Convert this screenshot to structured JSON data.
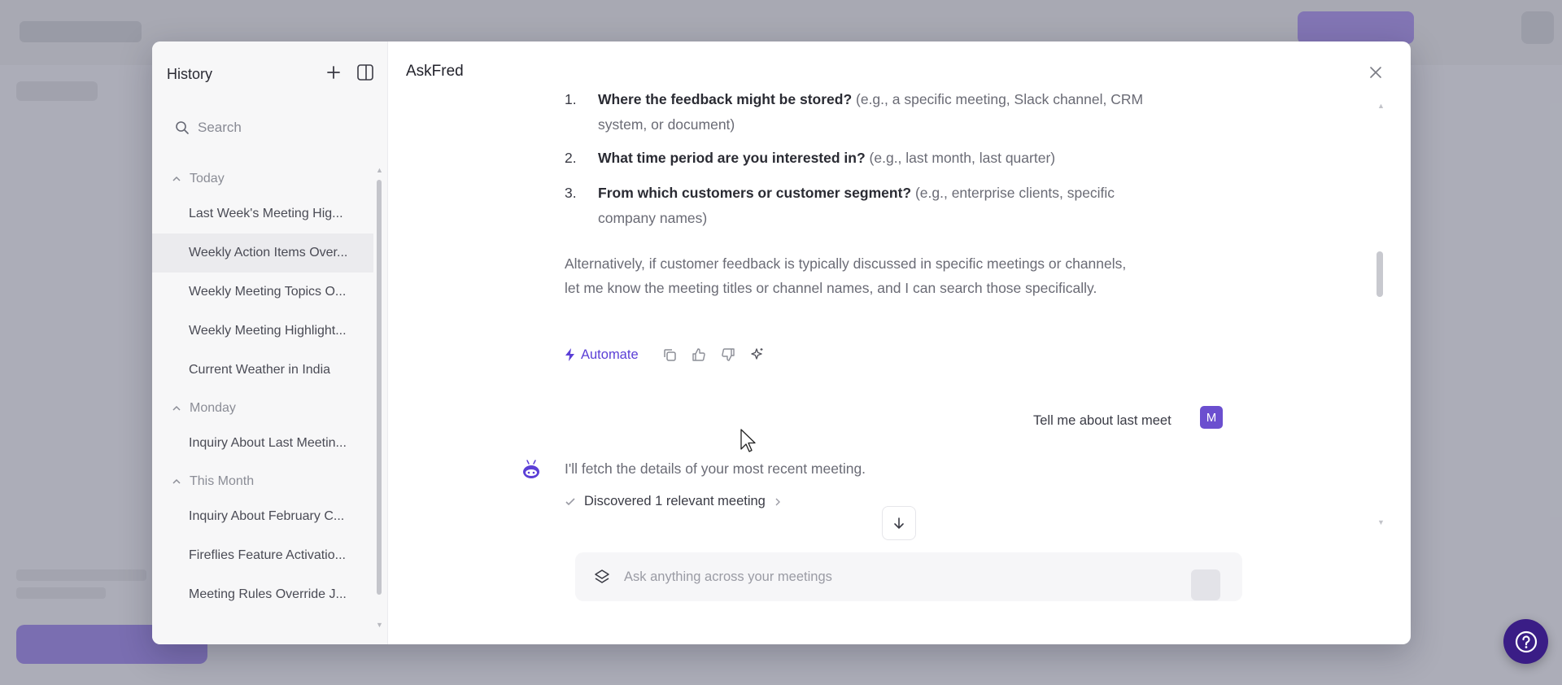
{
  "sidebar": {
    "title": "History",
    "search_placeholder": "Search",
    "groups": [
      {
        "label": "Today",
        "items": [
          "Last Week's Meeting Hig...",
          "Weekly Action Items Over...",
          "Weekly Meeting Topics O...",
          "Weekly Meeting Highlight...",
          "Current Weather in India"
        ]
      },
      {
        "label": "Monday",
        "items": [
          "Inquiry About Last Meetin..."
        ]
      },
      {
        "label": "This Month",
        "items": [
          "Inquiry About February C...",
          "Fireflies Feature Activatio...",
          "Meeting Rules Override J..."
        ]
      }
    ]
  },
  "main": {
    "title": "AskFred",
    "list": [
      {
        "num": "1.",
        "bold": "Where the feedback might be stored?",
        "rest": " (e.g., a specific meeting, Slack channel, CRM system, or document)"
      },
      {
        "num": "2.",
        "bold": "What time period are you interested in?",
        "rest": " (e.g., last month, last quarter)"
      },
      {
        "num": "3.",
        "bold": "From which customers or customer segment?",
        "rest": " (e.g., enterprise clients, specific company names)"
      }
    ],
    "paragraph": "Alternatively, if customer feedback is typically discussed in specific meetings or channels, let me know the meeting titles or channel names, and I can search those specifically.",
    "automate_label": "Automate",
    "user_message": "Tell me about last meet",
    "user_initial": "M",
    "bot_reply": "I'll fetch the details of your most recent meeting.",
    "discovered": "Discovered 1 relevant meeting",
    "input_placeholder": "Ask anything across your meetings"
  },
  "colors": {
    "accent": "#5b3fd6",
    "avatar": "#6b4fcf",
    "help": "#3a1d86"
  },
  "icons": [
    "plus-icon",
    "panel-toggle-icon",
    "search-icon",
    "chevron-up-icon",
    "close-icon",
    "bolt-icon",
    "copy-icon",
    "thumbs-up-icon",
    "thumbs-down-icon",
    "sparkle-icon",
    "bot-icon",
    "check-icon",
    "chevron-right-icon",
    "arrow-down-icon",
    "layers-icon",
    "help-icon"
  ]
}
